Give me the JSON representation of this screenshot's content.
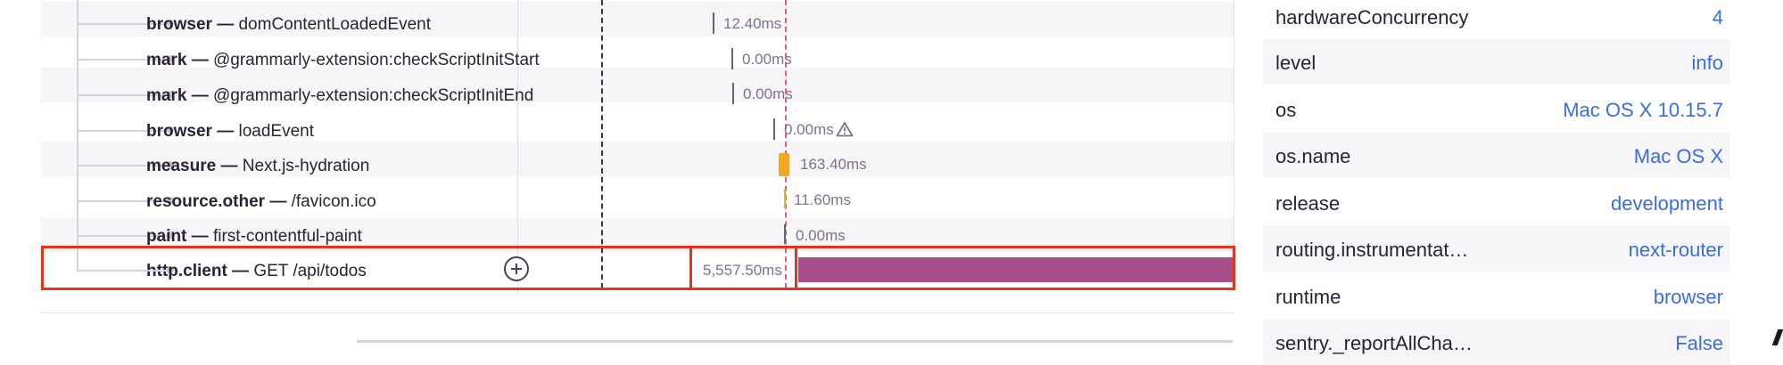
{
  "trace": {
    "spans": [
      {
        "op": "browser",
        "description": "domContentLoadedEvent",
        "duration": "12.40ms",
        "warning": false,
        "highlighted": false
      },
      {
        "op": "mark",
        "description": "@grammarly-extension:checkScriptInitStart",
        "duration": "0.00ms",
        "warning": false,
        "highlighted": false
      },
      {
        "op": "mark",
        "description": "@grammarly-extension:checkScriptInitEnd",
        "duration": "0.00ms",
        "warning": false,
        "highlighted": false
      },
      {
        "op": "browser",
        "description": "loadEvent",
        "duration": "0.00ms",
        "warning": true,
        "highlighted": false
      },
      {
        "op": "measure",
        "description": "Next.js-hydration",
        "duration": "163.40ms",
        "warning": false,
        "highlighted": false
      },
      {
        "op": "resource.other",
        "description": "/favicon.ico",
        "duration": "11.60ms",
        "warning": false,
        "highlighted": false
      },
      {
        "op": "paint",
        "description": "first-contentful-paint",
        "duration": "0.00ms",
        "warning": false,
        "highlighted": false
      },
      {
        "op": "http.client",
        "description": "GET /api/todos",
        "duration": "5,557.50ms",
        "warning": false,
        "highlighted": true
      }
    ],
    "separator": " — ",
    "colors": {
      "bar_orange": "#f5a623",
      "bar_purple": "#a64f8c",
      "highlight": "#e8331c",
      "tag_value": "#3a6ee0"
    }
  },
  "tags": [
    {
      "key": "hardwareConcurrency",
      "value": "4"
    },
    {
      "key": "level",
      "value": "info"
    },
    {
      "key": "os",
      "value": "Mac OS X 10.15.7"
    },
    {
      "key": "os.name",
      "value": "Mac OS X"
    },
    {
      "key": "release",
      "value": "development"
    },
    {
      "key": "routing.instrumentat…",
      "value": "next-router"
    },
    {
      "key": "runtime",
      "value": "browser"
    },
    {
      "key": "sentry._reportAllCha…",
      "value": "False"
    }
  ]
}
